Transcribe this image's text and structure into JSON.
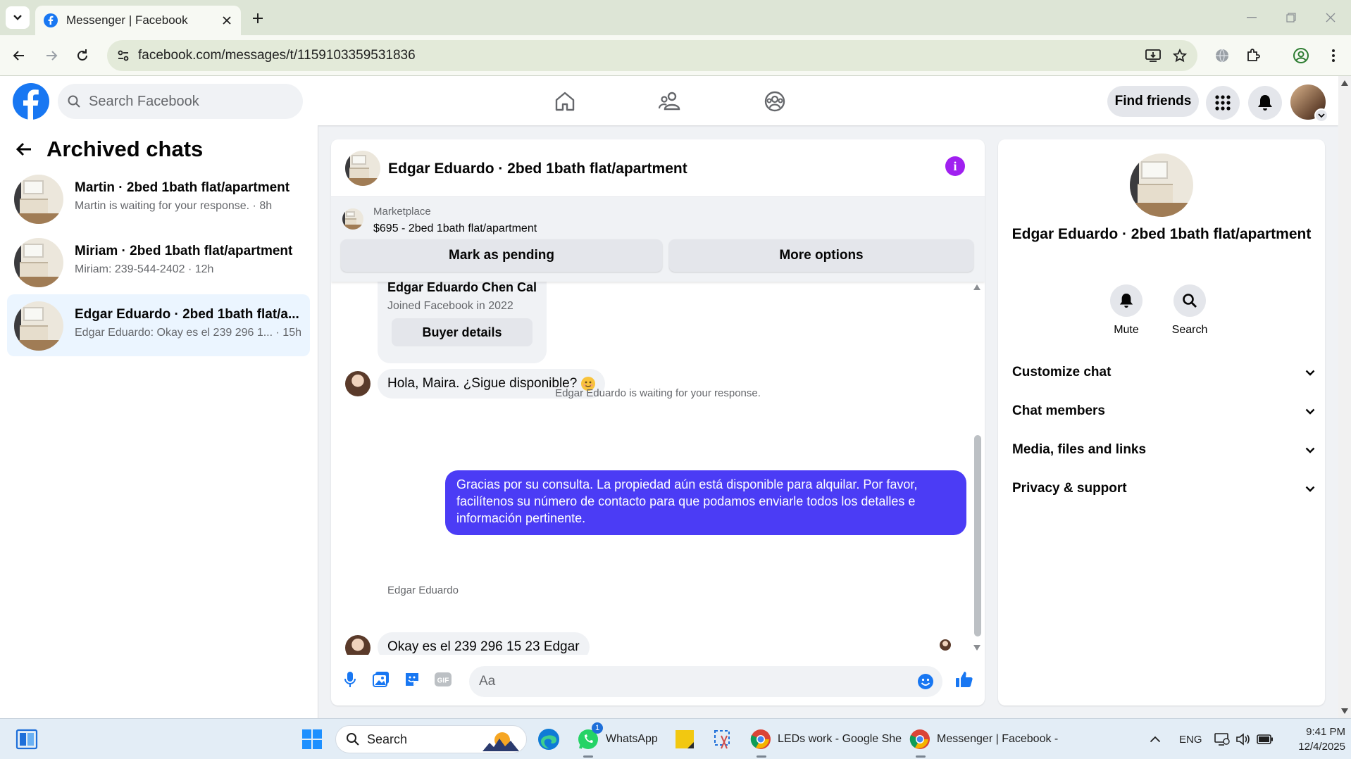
{
  "browser": {
    "tab_title": "Messenger | Facebook",
    "url": "facebook.com/messages/t/1159103359531836"
  },
  "fb_nav": {
    "search_placeholder": "Search Facebook",
    "find_friends": "Find friends"
  },
  "sidebar": {
    "title": "Archived chats",
    "chats": [
      {
        "name": "Martin · 2bed 1bath flat/apartment",
        "preview": "Martin is waiting for your response. · 8h"
      },
      {
        "name": "Miriam · 2bed 1bath flat/apartment",
        "preview": "Miriam: 239-544-2402 · 12h"
      },
      {
        "name": "Edgar Eduardo · 2bed 1bath flat/a...",
        "preview": "Edgar Eduardo: Okay es el 239 296 1... · 15h",
        "active": true
      }
    ]
  },
  "chat": {
    "title": "Edgar Eduardo · 2bed 1bath flat/apartment",
    "marketplace_label": "Marketplace",
    "listing": "$695 - 2bed 1bath flat/apartment",
    "mark_pending": "Mark as pending",
    "more_options": "More options",
    "buyer_card": {
      "name": "Edgar Eduardo Chen Cal",
      "joined": "Joined Facebook in 2022",
      "button": "Buyer details"
    },
    "messages": {
      "incoming_1": "Hola, Maira. ¿Sigue disponible?",
      "system_note": "Edgar Eduardo is waiting for your response.",
      "outgoing_1": "Gracias por su consulta. La propiedad aún está disponible para alquilar. Por favor, facilítenos su número de contacto para que podamos enviarle todos los detalles e información pertinente.",
      "sender_label": "Edgar Eduardo",
      "incoming_2": "Okay es el 239 296 15 23 Edgar"
    },
    "composer_placeholder": "Aa",
    "accent_color": "#4b3cf5"
  },
  "details_panel": {
    "title": "Edgar Eduardo · 2bed 1bath flat/apartment",
    "actions": [
      "Mute",
      "Search"
    ],
    "sections": [
      "Customize chat",
      "Chat members",
      "Media, files and links",
      "Privacy & support"
    ]
  },
  "taskbar": {
    "search": "Search",
    "whatsapp": "WhatsApp",
    "whatsapp_badge": "1",
    "chrome_1": "LEDs work - Google She",
    "chrome_2": "Messenger | Facebook -",
    "lang": "ENG",
    "time": "9:41 PM",
    "date": "12/4/2025"
  }
}
